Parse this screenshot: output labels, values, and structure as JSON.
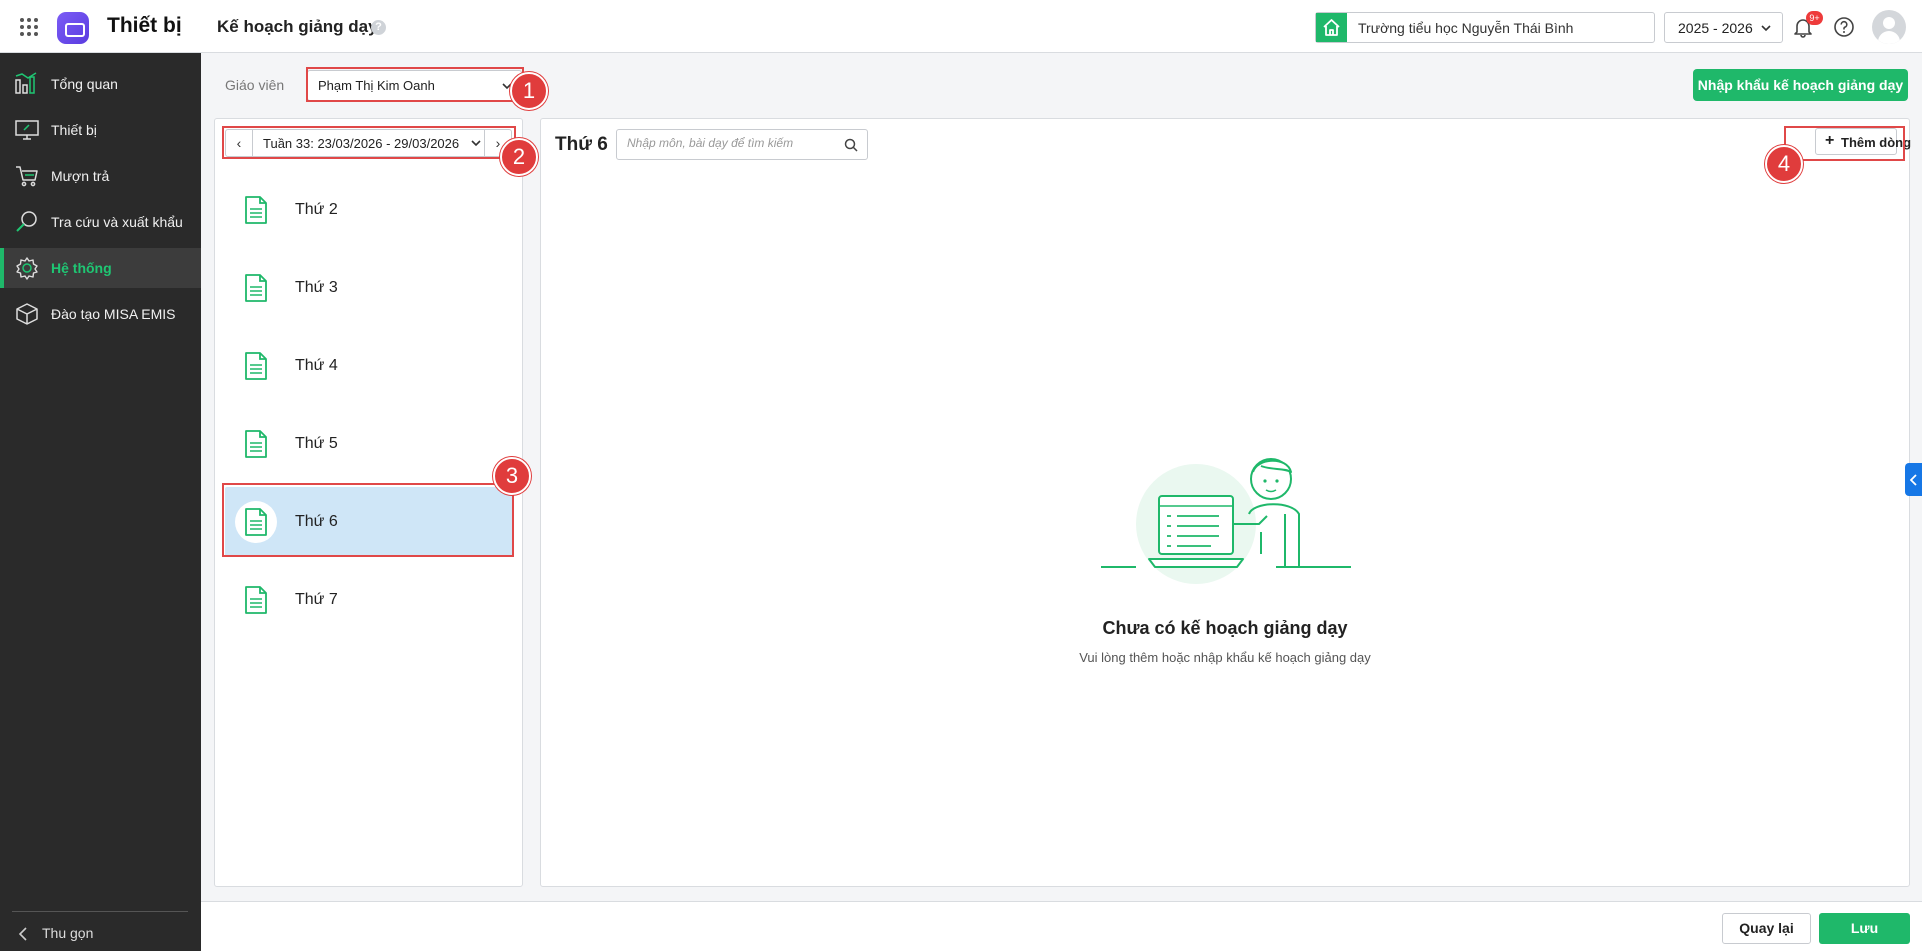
{
  "header": {
    "app_title": "Thiết bị",
    "page_title": "Kế hoạch giảng dạy",
    "page_help": "?",
    "school": "Trường tiểu học Nguyễn Thái Bình",
    "school_year": "2025 - 2026",
    "notification_badge": "9+"
  },
  "sidebar": {
    "items": [
      {
        "label": "Tổng quan",
        "icon": "chart-bars-icon"
      },
      {
        "label": "Thiết bị",
        "icon": "monitor-icon"
      },
      {
        "label": "Mượn trả",
        "icon": "cart-icon"
      },
      {
        "label": "Tra cứu và xuất khẩu",
        "icon": "search-icon"
      },
      {
        "label": "Hệ thống",
        "icon": "gear-icon"
      },
      {
        "label": "Đào tạo MISA EMIS",
        "icon": "cube-icon"
      }
    ],
    "active_index": 4,
    "collapse_label": "Thu gọn"
  },
  "filters": {
    "teacher_label": "Giáo viên",
    "teacher_value": "Phạm Thị Kim Oanh",
    "import_button": "Nhập khẩu kế hoạch giảng dạy"
  },
  "week": {
    "label": "Tuần 33: 23/03/2026 - 29/03/2026",
    "prev": "‹",
    "next": "›"
  },
  "days": [
    {
      "label": "Thứ 2"
    },
    {
      "label": "Thứ 3"
    },
    {
      "label": "Thứ 4"
    },
    {
      "label": "Thứ 5"
    },
    {
      "label": "Thứ 6"
    },
    {
      "label": "Thứ 7"
    }
  ],
  "selected_day": "Thứ 6",
  "detail": {
    "title": "Thứ 6",
    "search_placeholder": "Nhập môn, bài dạy để tìm kiếm",
    "add_row": "Thêm dòng",
    "empty_title": "Chưa có kế hoạch giảng dạy",
    "empty_subtitle": "Vui lòng thêm hoặc nhập khẩu kế hoạch giảng dạy"
  },
  "footer": {
    "back": "Quay lại",
    "save": "Lưu"
  },
  "annotations": [
    "1",
    "2",
    "3",
    "4"
  ],
  "colors": {
    "primary": "#1fb86a",
    "sidebar_bg": "#2a2a2a",
    "highlight": "#e04848",
    "selected_day_bg": "#cfe6f7"
  }
}
